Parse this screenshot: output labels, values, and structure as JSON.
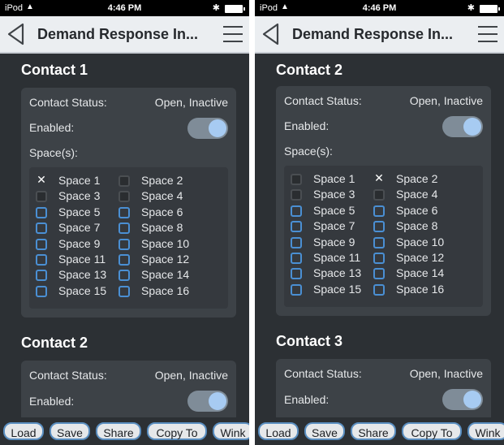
{
  "status_bar": {
    "carrier": "iPod",
    "time": "4:46 PM"
  },
  "nav": {
    "title": "Demand Response In..."
  },
  "toolbar": {
    "buttons": [
      "Load",
      "Save",
      "Share",
      "Copy To",
      "Wink"
    ]
  },
  "labels": {
    "contact_status": "Contact Status:",
    "contact_status_value": "Open, Inactive",
    "enabled": "Enabled:",
    "spaces": "Space(s):"
  },
  "spaces": [
    "Space 1",
    "Space 2",
    "Space 3",
    "Space 4",
    "Space 5",
    "Space 6",
    "Space 7",
    "Space 8",
    "Space 9",
    "Space 10",
    "Space 11",
    "Space 12",
    "Space 13",
    "Space 14",
    "Space 15",
    "Space 16"
  ],
  "screens": [
    {
      "sections": [
        {
          "title": "Contact 1",
          "enabled": true
        },
        {
          "title": "Contact 2",
          "enabled": true
        }
      ],
      "checked_space_index": 0,
      "disabled_space_indices": [
        1,
        2,
        3
      ]
    },
    {
      "sections": [
        {
          "title": "Contact 2",
          "enabled": true
        },
        {
          "title": "Contact 3",
          "enabled": true
        }
      ],
      "checked_space_index": 1,
      "disabled_space_indices": [
        0,
        2,
        3
      ]
    }
  ],
  "colors": {
    "accent": "#4a8fd3",
    "background": "#2c3034",
    "card": "#3d4247"
  }
}
